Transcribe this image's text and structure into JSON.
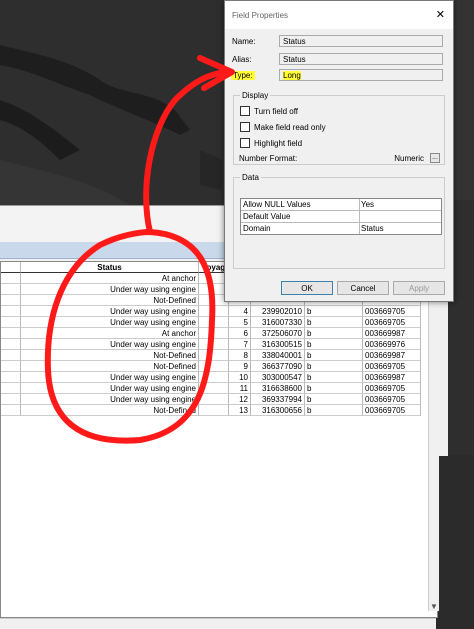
{
  "dialog": {
    "title": "Field Properties",
    "close_glyph": "✕",
    "name_label": "Name:",
    "name_value": "Status",
    "alias_label": "Alias:",
    "alias_value": "Status",
    "type_label": "Type:",
    "type_value": "Long",
    "display_group": "Display",
    "turn_field_off": "Turn field off",
    "make_read_only": "Make field read only",
    "highlight_field": "Highlight field",
    "number_format_label": "Number Format:",
    "number_format_value": "Numeric",
    "ellipsis": "...",
    "data_group": "Data",
    "properties": [
      {
        "key": "Allow NULL Values",
        "value": "Yes"
      },
      {
        "key": "Default Value",
        "value": ""
      },
      {
        "key": "Domain",
        "value": "Status"
      }
    ],
    "ok_label": "OK",
    "cancel_label": "Cancel",
    "apply_label": "Apply"
  },
  "table": {
    "headers": [
      "",
      "Status",
      "Voyag",
      "",
      "",
      "",
      ""
    ],
    "rows": [
      {
        "status": "At anchor",
        "n": "",
        "mmsi": "",
        "b": "",
        "code": ""
      },
      {
        "status": "Under way using engine",
        "n": "",
        "mmsi": "",
        "b": "",
        "code": ""
      },
      {
        "status": "Not-Defined",
        "n": "",
        "mmsi": "",
        "b": "",
        "code": ""
      },
      {
        "status": "Under way using engine",
        "n": "4",
        "mmsi": "239902010",
        "b": "b",
        "code": "003669705"
      },
      {
        "status": "Under way using engine",
        "n": "5",
        "mmsi": "316007330",
        "b": "b",
        "code": "003669705"
      },
      {
        "status": "At anchor",
        "n": "6",
        "mmsi": "372506070",
        "b": "b",
        "code": "003669987"
      },
      {
        "status": "Under way using engine",
        "n": "7",
        "mmsi": "316300515",
        "b": "b",
        "code": "003669976"
      },
      {
        "status": "Not-Defined",
        "n": "8",
        "mmsi": "338040001",
        "b": "b",
        "code": "003669987"
      },
      {
        "status": "Not-Defined",
        "n": "9",
        "mmsi": "366377090",
        "b": "b",
        "code": "003669705"
      },
      {
        "status": "Under way using engine",
        "n": "10",
        "mmsi": "303000547",
        "b": "b",
        "code": "003669987"
      },
      {
        "status": "Under way using engine",
        "n": "11",
        "mmsi": "316638600",
        "b": "b",
        "code": "003669705"
      },
      {
        "status": "Under way using engine",
        "n": "12",
        "mmsi": "369337994",
        "b": "b",
        "code": "003669705"
      },
      {
        "status": "Not-Defined",
        "n": "13",
        "mmsi": "316300656",
        "b": "b",
        "code": "003669705"
      }
    ]
  },
  "colors": {
    "highlight": "#ffff33",
    "annotation": "#ff1a1a"
  }
}
